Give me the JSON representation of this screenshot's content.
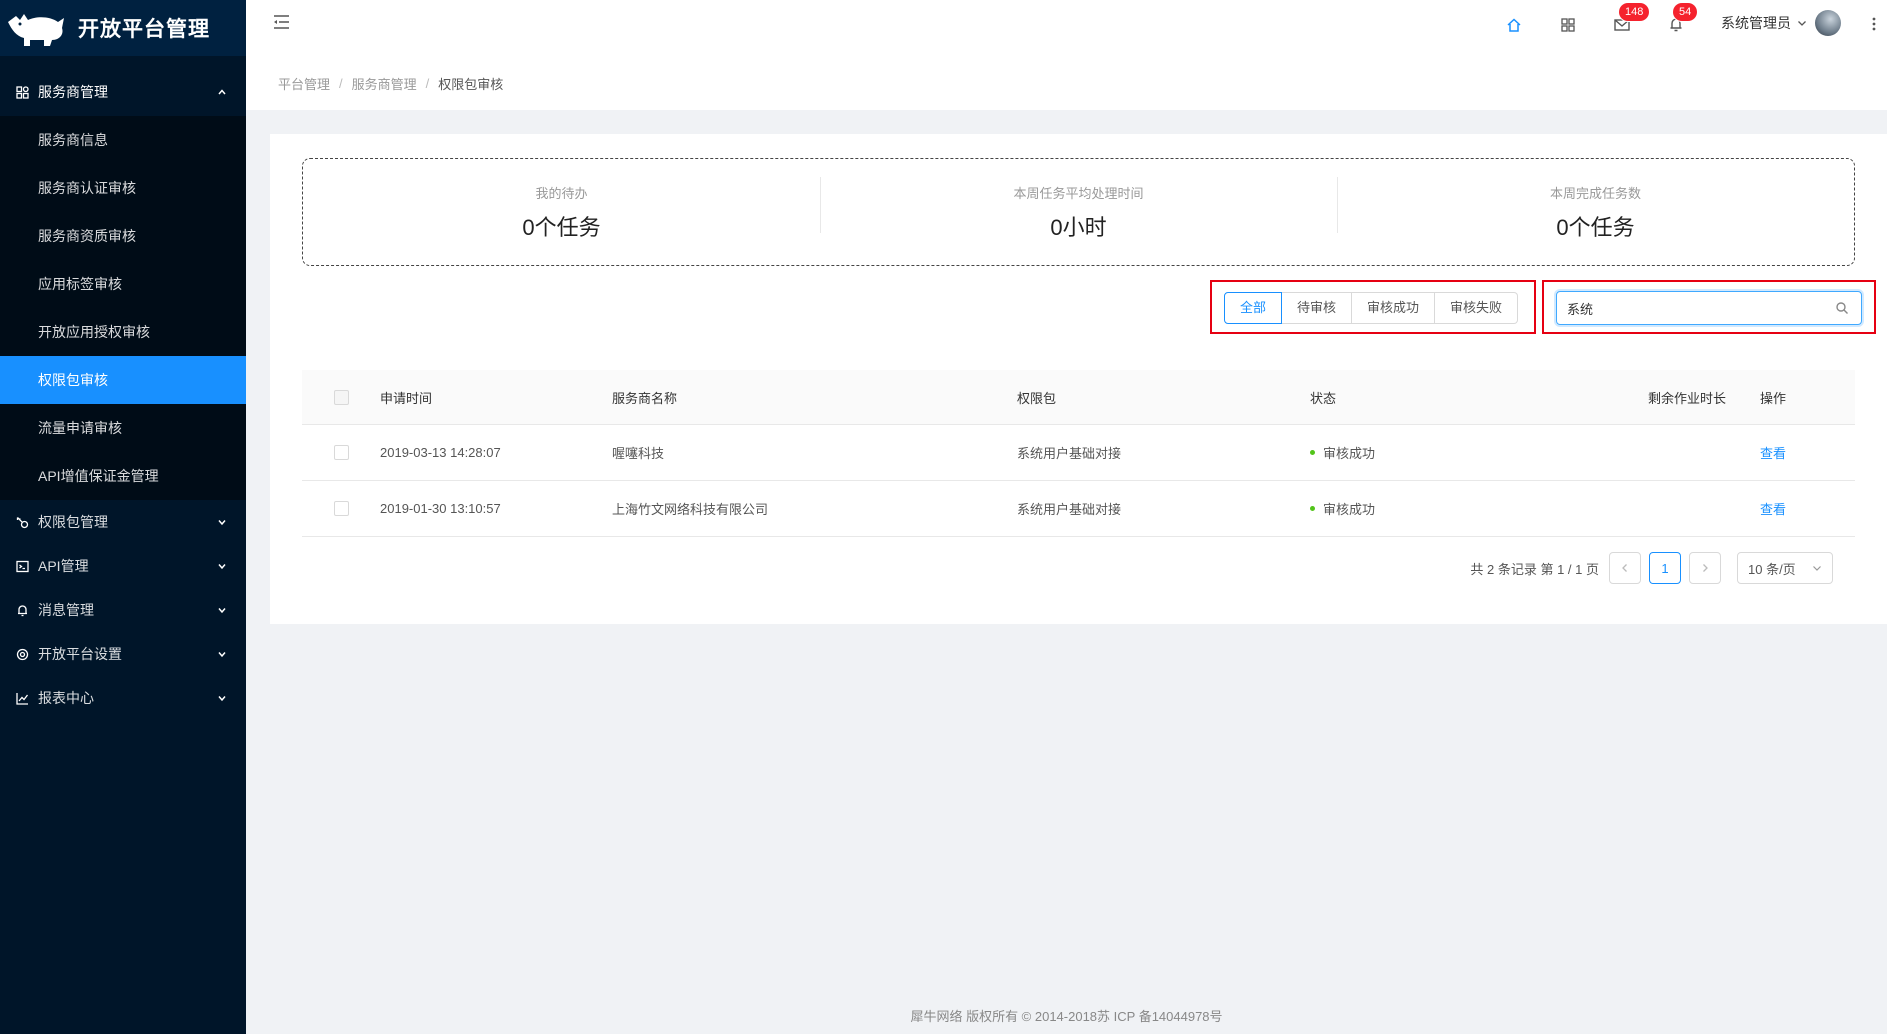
{
  "app": {
    "title": "开放平台管理"
  },
  "sidebar": {
    "group": {
      "label": "服务商管理",
      "items": [
        {
          "label": "服务商信息",
          "active": false
        },
        {
          "label": "服务商认证审核",
          "active": false
        },
        {
          "label": "服务商资质审核",
          "active": false
        },
        {
          "label": "应用标签审核",
          "active": false
        },
        {
          "label": "开放应用授权审核",
          "active": false
        },
        {
          "label": "权限包审核",
          "active": true
        },
        {
          "label": "流量申请审核",
          "active": false
        },
        {
          "label": "API增值保证金管理",
          "active": false
        }
      ]
    },
    "menus": [
      {
        "label": "权限包管理",
        "icon": "key-icon"
      },
      {
        "label": "API管理",
        "icon": "terminal-icon"
      },
      {
        "label": "消息管理",
        "icon": "bell-icon"
      },
      {
        "label": "开放平台设置",
        "icon": "gear-icon"
      },
      {
        "label": "报表中心",
        "icon": "line-chart-icon"
      }
    ]
  },
  "header": {
    "mail_badge": "148",
    "bell_badge": "54",
    "user_name": "系统管理员"
  },
  "breadcrumb": [
    "平台管理",
    "服务商管理",
    "权限包审核"
  ],
  "stats": [
    {
      "label": "我的待办",
      "value": "0个任务"
    },
    {
      "label": "本周任务平均处理时间",
      "value": "0小时"
    },
    {
      "label": "本周完成任务数",
      "value": "0个任务"
    }
  ],
  "filters": [
    {
      "label": "全部",
      "active": true
    },
    {
      "label": "待审核",
      "active": false
    },
    {
      "label": "审核成功",
      "active": false
    },
    {
      "label": "审核失败",
      "active": false
    }
  ],
  "search": {
    "value": "系统",
    "placeholder": ""
  },
  "table": {
    "columns": [
      "申请时间",
      "服务商名称",
      "权限包",
      "状态",
      "剩余作业时长",
      "操作"
    ],
    "rows": [
      {
        "time": "2019-03-13 14:28:07",
        "provider": "喔噻科技",
        "package": "系统用户基础对接",
        "status": "审核成功",
        "remaining": "",
        "action": "查看"
      },
      {
        "time": "2019-01-30 13:10:57",
        "provider": "上海竹文网络科技有限公司",
        "package": "系统用户基础对接",
        "status": "审核成功",
        "remaining": "",
        "action": "查看"
      }
    ]
  },
  "pagination": {
    "total_text": "共 2 条记录 第 1 / 1 页",
    "current": "1",
    "page_size": "10 条/页"
  },
  "footer": {
    "text": "犀牛网络 版权所有 © 2014-2018苏 ICP 备14044978号"
  },
  "colors": {
    "primary": "#1890ff",
    "sidebar_bg": "#001529",
    "highlight_border": "#e60012",
    "success": "#52c41a",
    "badge": "#f5222d"
  }
}
